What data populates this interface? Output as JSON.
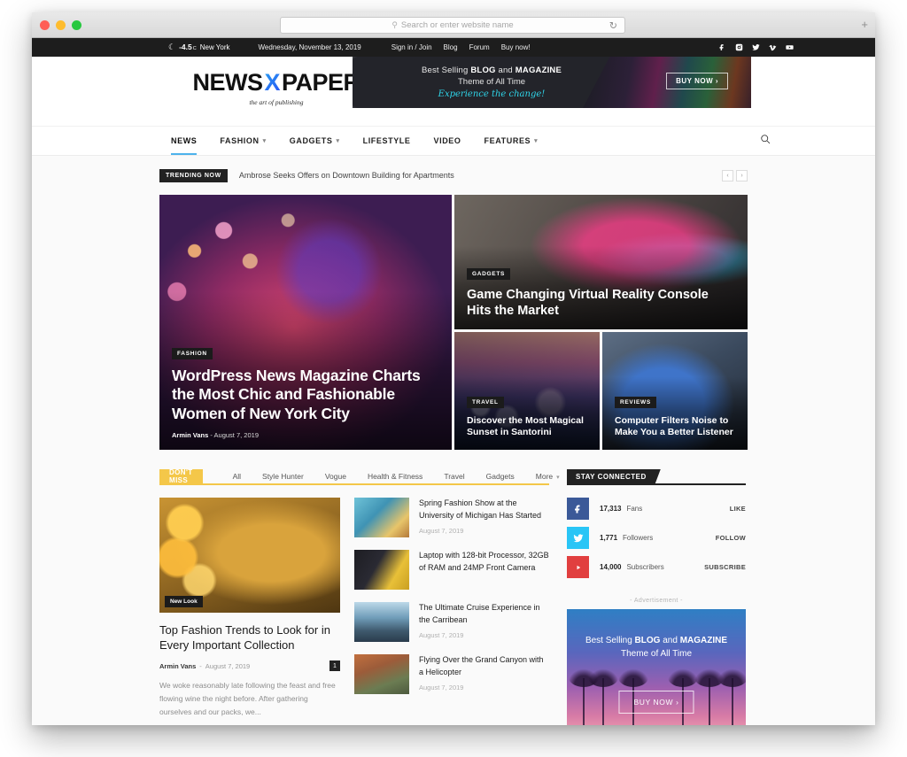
{
  "browser": {
    "url_placeholder": "Search or enter website name",
    "reload_icon": "reload-icon",
    "new_tab_icon": "plus-icon"
  },
  "topbar": {
    "temperature": "-4.5",
    "temperature_unit": "C",
    "city": "New York",
    "date": "Wednesday, November 13, 2019",
    "links": [
      {
        "label": "Sign in / Join"
      },
      {
        "label": "Blog"
      },
      {
        "label": "Forum"
      },
      {
        "label": "Buy now!"
      }
    ],
    "social": [
      {
        "name": "facebook-icon"
      },
      {
        "name": "instagram-icon"
      },
      {
        "name": "twitter-icon"
      },
      {
        "name": "vimeo-icon"
      },
      {
        "name": "youtube-icon"
      }
    ]
  },
  "header": {
    "logo_part1": "NEWS",
    "logo_x": "X",
    "logo_part2": "PAPER",
    "tagline": "the art of publishing",
    "ad": {
      "line1_pre": "Best Selling ",
      "line1_b1": "BLOG",
      "line1_mid": " and ",
      "line1_b2": "MAGAZINE",
      "line2": "Theme of All Time",
      "line3": "Experience the change!",
      "button": "BUY NOW  ›"
    }
  },
  "nav": {
    "items": [
      {
        "label": "NEWS",
        "has_caret": false,
        "active": true
      },
      {
        "label": "FASHION",
        "has_caret": true,
        "active": false
      },
      {
        "label": "GADGETS",
        "has_caret": true,
        "active": false
      },
      {
        "label": "LIFESTYLE",
        "has_caret": false,
        "active": false
      },
      {
        "label": "VIDEO",
        "has_caret": false,
        "active": false
      },
      {
        "label": "FEATURES",
        "has_caret": true,
        "active": false
      }
    ],
    "search_icon": "search-icon"
  },
  "trending": {
    "badge": "TRENDING NOW",
    "headline": "Ambrose Seeks Offers on Downtown Building for Apartments",
    "prev": "‹",
    "next": "›"
  },
  "hero": {
    "main": {
      "category": "FASHION",
      "title": "WordPress News Magazine Charts the Most Chic and Fashionable Women of New York City",
      "author": "Armin Vans",
      "date": "August 7, 2019",
      "separator": "-"
    },
    "vr": {
      "category": "GADGETS",
      "title": "Game Changing Virtual Reality Console Hits the Market"
    },
    "santorini": {
      "category": "TRAVEL",
      "title": "Discover the Most Magical Sunset in Santorini"
    },
    "reviews": {
      "category": "REVIEWS",
      "title": "Computer Filters Noise to Make You a Better Listener"
    }
  },
  "dont_miss": {
    "badge": "DON'T MISS",
    "tabs": [
      {
        "label": "All",
        "caret": false
      },
      {
        "label": "Style Hunter",
        "caret": false
      },
      {
        "label": "Vogue",
        "caret": false
      },
      {
        "label": "Health & Fitness",
        "caret": false
      },
      {
        "label": "Travel",
        "caret": false
      },
      {
        "label": "Gadgets",
        "caret": false
      },
      {
        "label": "More",
        "caret": true
      }
    ],
    "feature": {
      "badge": "New Look",
      "title": "Top Fashion Trends to Look for in Every Important Collection",
      "author": "Armin Vans",
      "separator": "-",
      "date": "August 7, 2019",
      "comments": "1",
      "excerpt": "We woke reasonably late following the feast and free flowing wine the night before. After gathering ourselves and our packs, we..."
    },
    "items": [
      {
        "title": "Spring Fashion Show at the University of Michigan Has Started",
        "date": "August 7, 2019",
        "thumb": "img-fashionshow"
      },
      {
        "title": "Laptop with 128-bit Processor, 32GB of RAM and 24MP Front Camera",
        "date": "",
        "thumb": "img-laptop"
      },
      {
        "title": "The Ultimate Cruise Experience in the Carribean",
        "date": "August 7, 2019",
        "thumb": "img-cruise"
      },
      {
        "title": "Flying Over the Grand Canyon with a Helicopter",
        "date": "August 7, 2019",
        "thumb": "img-canyon"
      }
    ]
  },
  "sidebar": {
    "stay_connected_title": "STAY CONNECTED",
    "social": [
      {
        "network": "facebook",
        "icon": "facebook-icon",
        "count": "17,313",
        "label": "Fans",
        "action": "LIKE",
        "color": "#3b5998"
      },
      {
        "network": "twitter",
        "icon": "twitter-icon",
        "count": "1,771",
        "label": "Followers",
        "action": "FOLLOW",
        "color": "#29c5f6"
      },
      {
        "network": "youtube",
        "icon": "youtube-icon",
        "count": "14,000",
        "label": "Subscribers",
        "action": "SUBSCRIBE",
        "color": "#e13f3f"
      }
    ],
    "ad_label": "- Advertisement -",
    "ad": {
      "line1_pre": "Best Selling ",
      "line1_b1": "BLOG",
      "line1_mid": " and ",
      "line1_b2": "MAGAZINE",
      "line2": "Theme of All Time",
      "button": "BUY NOW  ›"
    }
  }
}
